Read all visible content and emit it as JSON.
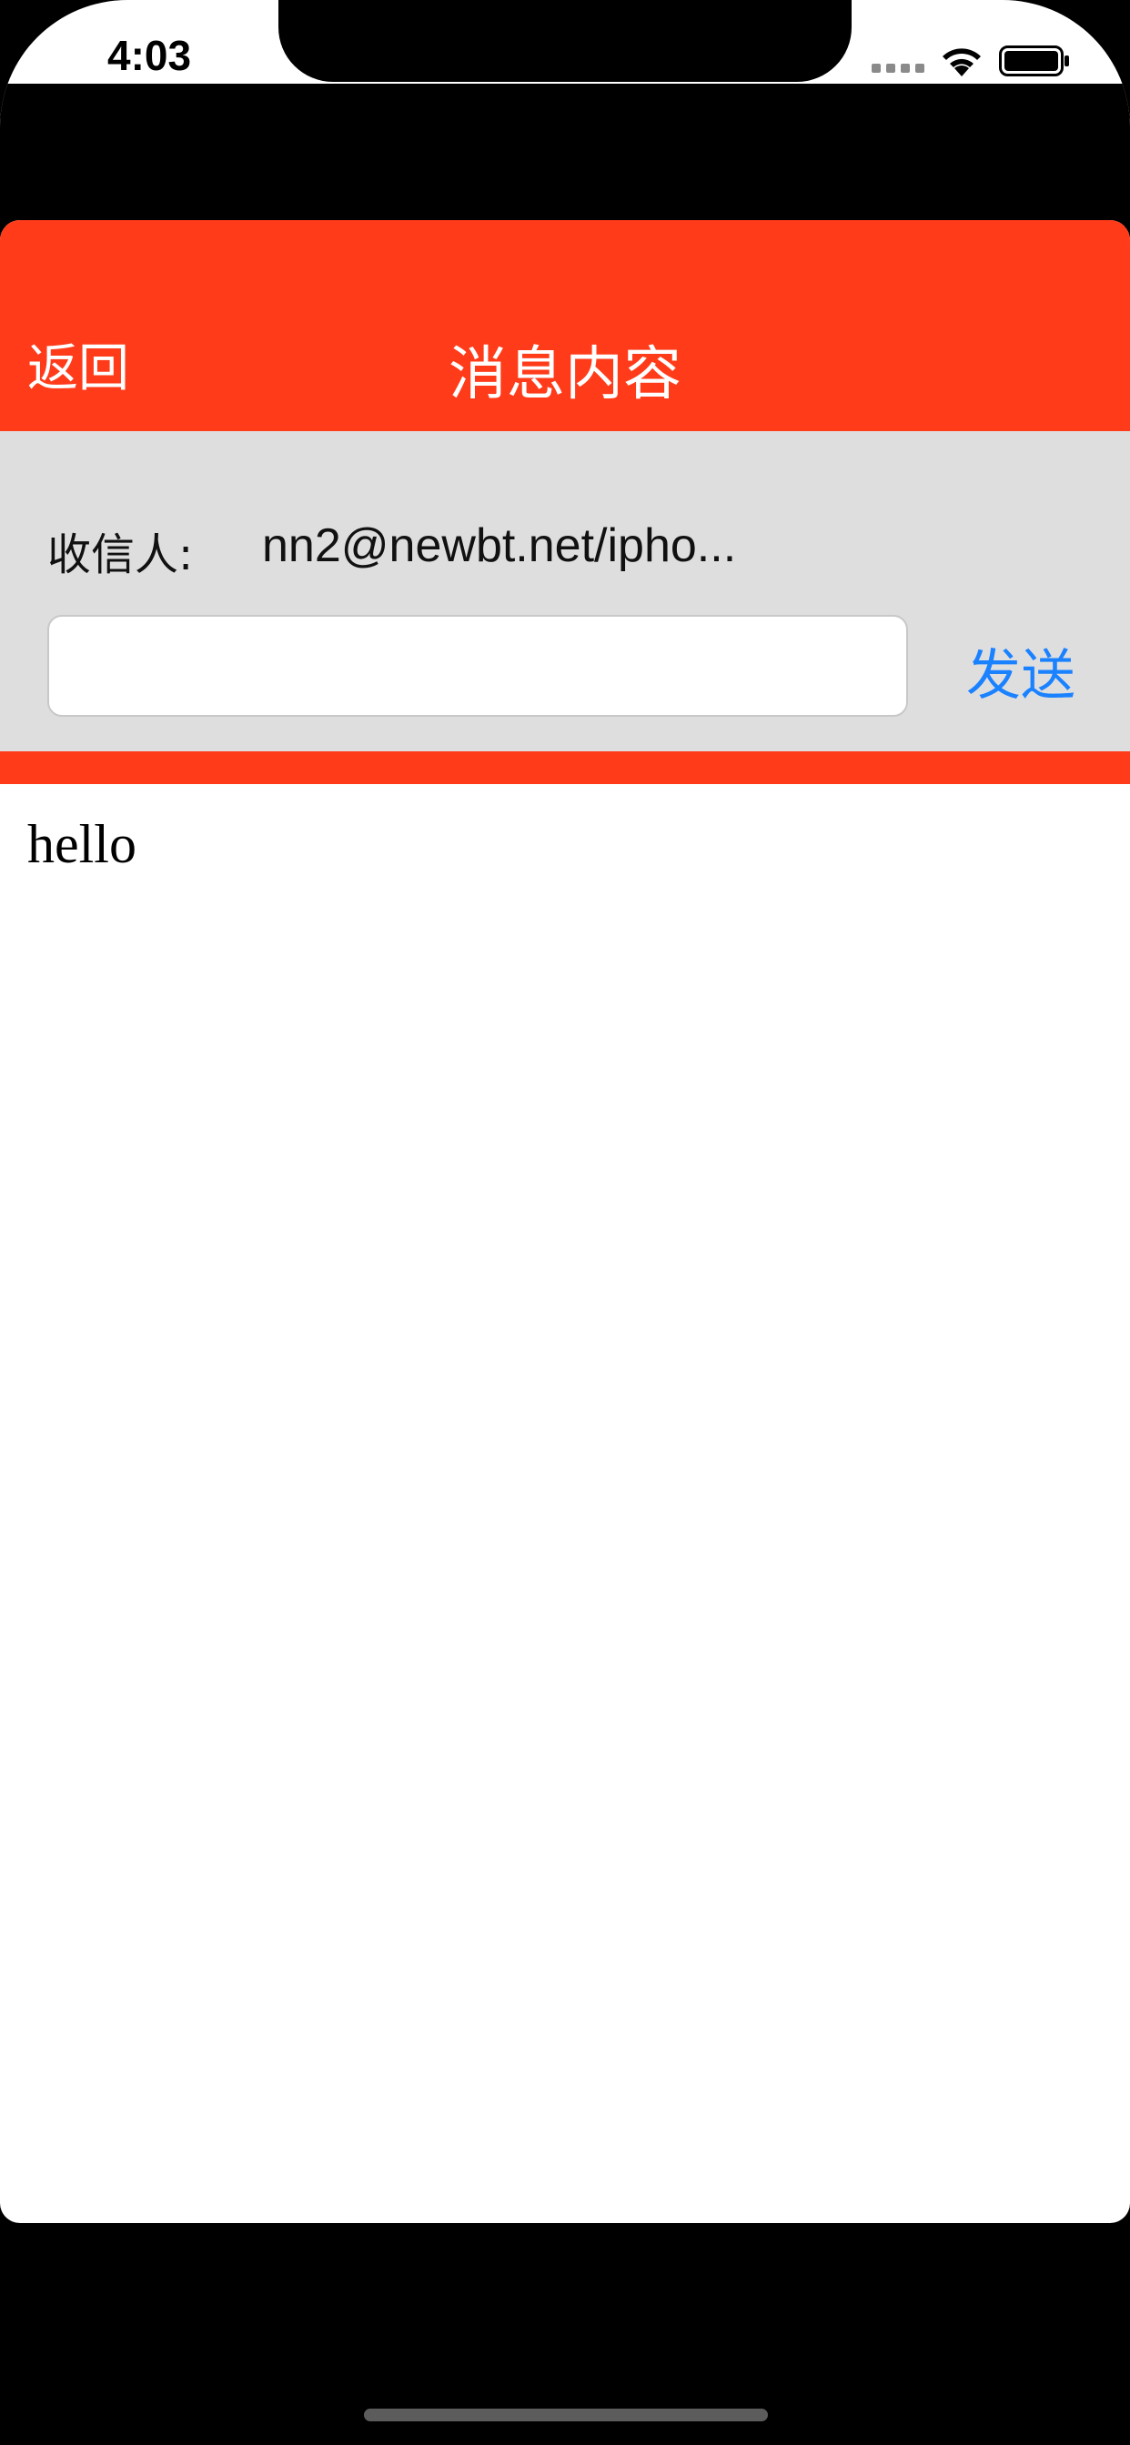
{
  "status_bar": {
    "time": "4:03",
    "icons": [
      "cellular-signal-icon",
      "wifi-icon",
      "battery-icon"
    ]
  },
  "nav": {
    "back_label": "返回",
    "title": "消息内容"
  },
  "compose": {
    "recipient_label": "收信人:",
    "recipient_value": "nn2@newbt.net/ipho...",
    "input_value": "",
    "send_label": "发送"
  },
  "message": {
    "body": "hello"
  },
  "colors": {
    "nav_background": "#ff3b1a",
    "compose_background": "#dfdedf",
    "send_accent": "#1a82ff"
  }
}
